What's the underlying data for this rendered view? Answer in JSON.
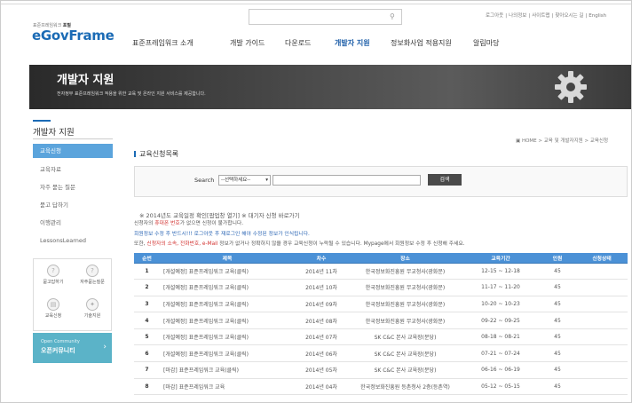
{
  "header": {
    "brand_small_prefix": "표준프레임워크",
    "brand_small_bold": "포털",
    "brand_logo": "eGovFrame",
    "util_links": [
      "로그아웃",
      "|",
      "나의정보",
      "|",
      "사이트맵",
      "|",
      "찾아오시는 길",
      "|",
      "English"
    ],
    "search_placeholder": ""
  },
  "gnb": [
    {
      "label": "표준프레임워크 소개",
      "active": false
    },
    {
      "label": "개발 가이드",
      "active": false
    },
    {
      "label": "다운로드",
      "active": false
    },
    {
      "label": "개발자 지원",
      "active": true
    },
    {
      "label": "정보화사업 적용지원",
      "active": false
    },
    {
      "label": "알림마당",
      "active": false
    }
  ],
  "banner": {
    "title": "개발자 지원",
    "desc": "전자정부 표준프레임워크 적용을 위한 교육 및 온라인 지원 서비스를 제공합니다."
  },
  "lnb": {
    "title": "개발자 지원",
    "items": [
      {
        "label": "교육신청",
        "active": true
      },
      {
        "label": "교육자료",
        "active": false
      },
      {
        "label": "자주 묻는 질문",
        "active": false
      },
      {
        "label": "묻고 답하기",
        "active": false
      },
      {
        "label": "이행관리",
        "active": false
      },
      {
        "label": "LessonsLearned",
        "active": false
      }
    ]
  },
  "quick": [
    {
      "label": "묻고답하기",
      "icon": "qna-icon"
    },
    {
      "label": "자주묻는질문",
      "icon": "faq-icon"
    },
    {
      "label": "교육신청",
      "icon": "education-icon"
    },
    {
      "label": "기술지원",
      "icon": "support-icon"
    }
  ],
  "community": {
    "en": "Open Community",
    "ko": "오픈커뮤니티",
    "arrow": "›"
  },
  "breadcrumb": "HOME > 교육 및 개발자지원 > 교육신청",
  "section_title": "교육신청목록",
  "search": {
    "label": "Search",
    "select_value": "--선택하세요--",
    "keyword": "",
    "button": "검색"
  },
  "links_line": "※ 2014년도 교육일정 확인[팝업창 열기]     ※ 대기자 신청 바로가기",
  "notices": [
    {
      "parts": [
        [
          "",
          "신청자의 "
        ],
        [
          "red",
          "휴대폰 번호"
        ],
        [
          "",
          "가 없으면 신청이 불가합니다."
        ]
      ]
    },
    {
      "parts": [
        [
          "blue",
          "회원정보 수정 후 반드시!!! 로그아웃 후 재로그인 해야 수정된 정보가 인식됩니다."
        ]
      ]
    },
    {
      "parts": [
        [
          "",
          "또한, "
        ],
        [
          "red",
          "신청자의 소속, 전화번호, e-Mail"
        ],
        [
          "",
          " 정보가 없거나 정확하지 않을 경우 교육신청이 누락될 수 있습니다. Mypage에서 회원정보 수정 후 신청해 주세요."
        ]
      ]
    }
  ],
  "table": {
    "headers": [
      "순번",
      "제목",
      "차수",
      "장소",
      "교육기간",
      "인원",
      "신청상태"
    ],
    "rows": [
      [
        "1",
        "[개설예정] 표준프레임워크 교육(클릭)",
        "2014년 11차",
        "한국정보화진흥원 무교청사(광화문)",
        "12-15 ~ 12-18",
        "45",
        ""
      ],
      [
        "2",
        "[개설예정] 표준프레임워크 교육(클릭)",
        "2014년 10차",
        "한국정보화진흥원 무교청사(광화문)",
        "11-17 ~ 11-20",
        "45",
        ""
      ],
      [
        "3",
        "[개설예정] 표준프레임워크 교육(클릭)",
        "2014년 09차",
        "한국정보화진흥원 무교청사(광화문)",
        "10-20 ~ 10-23",
        "45",
        ""
      ],
      [
        "4",
        "[개설예정] 표준프레임워크 교육(클릭)",
        "2014년 08차",
        "한국정보화진흥원 무교청사(광화문)",
        "09-22 ~ 09-25",
        "45",
        ""
      ],
      [
        "5",
        "[개설예정] 표준프레임워크 교육(클릭)",
        "2014년 07차",
        "SK C&C 본사 교육장(분당)",
        "08-18 ~ 08-21",
        "45",
        ""
      ],
      [
        "6",
        "[개설예정] 표준프레임워크 교육(클릭)",
        "2014년 06차",
        "SK C&C 본사 교육장(분당)",
        "07-21 ~ 07-24",
        "45",
        ""
      ],
      [
        "7",
        "[마감] 표준프레임워크 교육(클릭)",
        "2014년 05차",
        "SK C&C 본사 교육장(분당)",
        "06-16 ~ 06-19",
        "45",
        ""
      ],
      [
        "8",
        "[마감] 표준프레임워크 교육",
        "2014년 04차",
        "한국정보화진흥원 등촌청사 2층(등촌역)",
        "05-12 ~ 05-15",
        "45",
        ""
      ]
    ]
  },
  "colors": {
    "brand": "#1b6bb5",
    "table_header": "#4b91d6",
    "lnb_active": "#5ba4dc",
    "community": "#5bb3c8",
    "notice_red": "#d2302e",
    "notice_blue": "#2a65b4"
  }
}
